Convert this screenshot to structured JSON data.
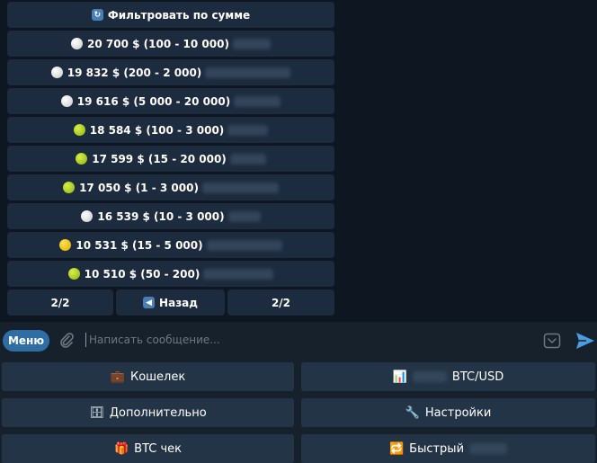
{
  "inline_keyboard": {
    "filter_label": "Фильтровать по сумме",
    "offers": [
      {
        "amount": "20 700 $ (100 - 10 000)",
        "coin": "white",
        "blur_width": 42
      },
      {
        "amount": "19 832 $ (200 - 2 000)",
        "coin": "white",
        "blur_width": 95
      },
      {
        "amount": "19 616 $ (5 000 - 20 000)",
        "coin": "white",
        "blur_width": 52
      },
      {
        "amount": "18 584 $ (100 - 3 000)",
        "coin": "tennis",
        "blur_width": 45
      },
      {
        "amount": "17 599 $ (15 - 20 000)",
        "coin": "tennis",
        "blur_width": 40
      },
      {
        "amount": "17 050 $ (1 - 3 000)",
        "coin": "tennis",
        "blur_width": 85
      },
      {
        "amount": "16 539 $ (10 - 3 000)",
        "coin": "white",
        "blur_width": 36
      },
      {
        "amount": "10 531 $ (15 - 5 000)",
        "coin": "yellow",
        "blur_width": 84
      },
      {
        "amount": "10 510 $ (50 - 200)",
        "coin": "tennis",
        "blur_width": 78
      }
    ],
    "page_left": "2/2",
    "back_label": "Назад",
    "page_right": "2/2"
  },
  "input": {
    "menu_label": "Меню",
    "placeholder": "Написать сообщение..."
  },
  "reply_keyboard": {
    "wallet": "Кошелек",
    "btc_usd": "BTC/USD",
    "additional": "Дополнительно",
    "settings": "Настройки",
    "btc_check": "BTC чек",
    "fast": "Быстрый"
  },
  "colors": {
    "background": "#0e1621",
    "button": "#1c2b3d",
    "accent": "#2f6ea5"
  }
}
